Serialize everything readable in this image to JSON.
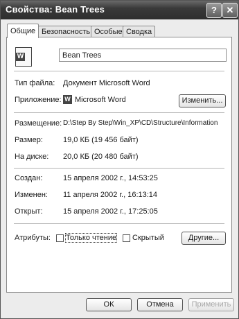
{
  "window": {
    "title": "Свойства: Bean Trees",
    "help_glyph": "?",
    "close_glyph": "✕"
  },
  "tabs": [
    {
      "label": "Общие",
      "active": true
    },
    {
      "label": "Безопасность",
      "active": false
    },
    {
      "label": "Особые",
      "active": false
    },
    {
      "label": "Сводка",
      "active": false
    }
  ],
  "general": {
    "file_name": "Bean Trees",
    "file_type": {
      "label": "Тип файла:",
      "value": "Документ Microsoft Word"
    },
    "opens_with": {
      "label": "Приложение:",
      "value": "Microsoft Word",
      "change_button": "Изменить..."
    },
    "location": {
      "label": "Размещение:",
      "value": "D:\\Step By Step\\Win_XP\\CD\\Structure\\Information"
    },
    "size": {
      "label": "Размер:",
      "value": "19,0 КБ (19 456 байт)"
    },
    "size_on_disk": {
      "label": "На диске:",
      "value": "20,0 КБ (20 480 байт)"
    },
    "created": {
      "label": "Создан:",
      "value": "15 апреля 2002 г., 14:53:25"
    },
    "modified": {
      "label": "Изменен:",
      "value": "11 апреля 2002 г., 16:13:14"
    },
    "accessed": {
      "label": "Открыт:",
      "value": "15 апреля 2002 г., 17:25:05"
    },
    "attributes": {
      "label": "Атрибуты:",
      "read_only": {
        "label": "Только чтение",
        "checked": false
      },
      "hidden": {
        "label": "Скрытый",
        "checked": false
      },
      "advanced_button": "Другие..."
    }
  },
  "footer": {
    "ok": "ОК",
    "cancel": "Отмена",
    "apply": "Применить"
  }
}
